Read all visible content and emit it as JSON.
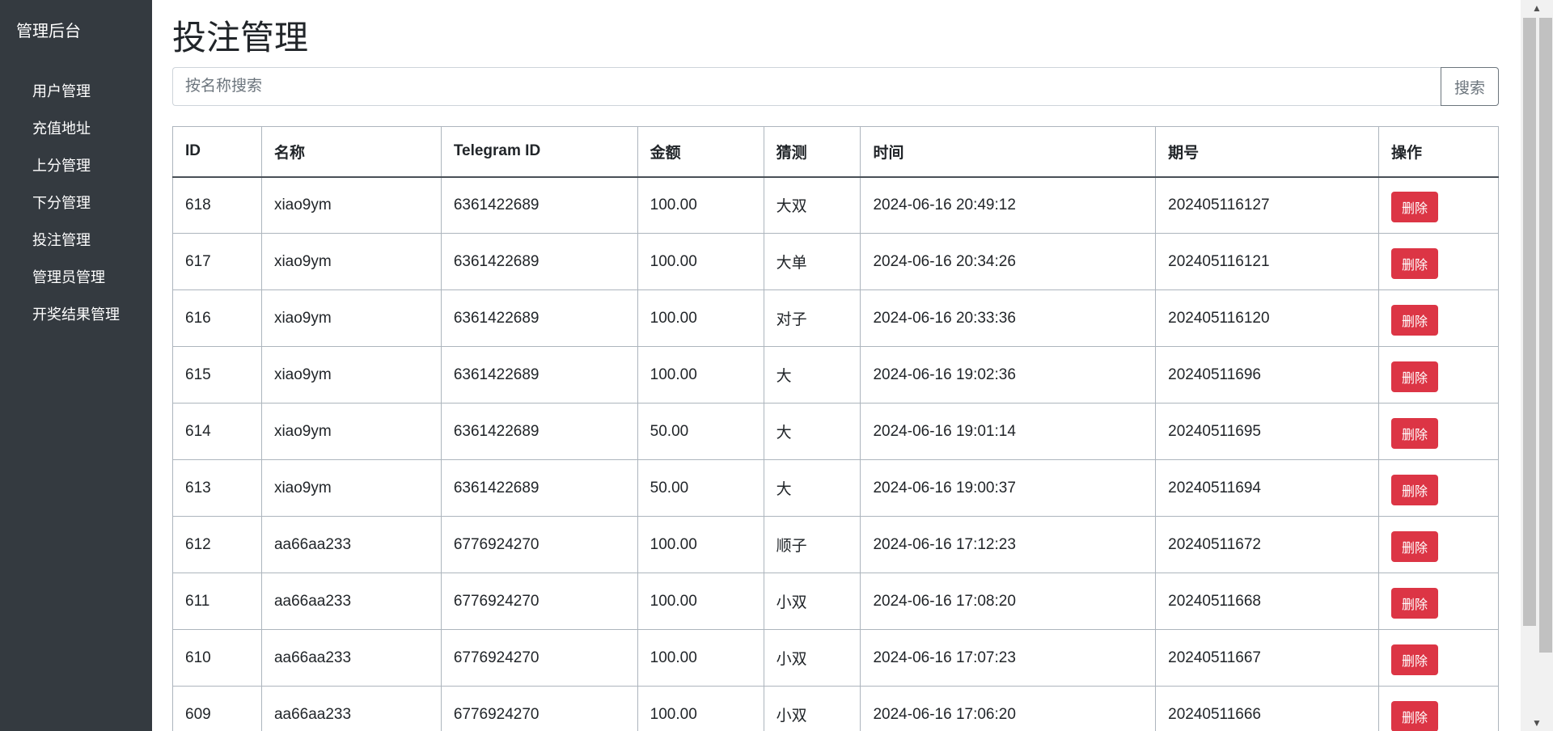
{
  "sidebar": {
    "brand": "管理后台",
    "items": [
      {
        "label": "用户管理"
      },
      {
        "label": "充值地址"
      },
      {
        "label": "上分管理"
      },
      {
        "label": "下分管理"
      },
      {
        "label": "投注管理"
      },
      {
        "label": "管理员管理"
      },
      {
        "label": "开奖结果管理"
      }
    ]
  },
  "main": {
    "title": "投注管理",
    "search": {
      "placeholder": "按名称搜索",
      "value": "",
      "button_label": "搜索"
    },
    "table": {
      "headers": [
        "ID",
        "名称",
        "Telegram ID",
        "金额",
        "猜测",
        "时间",
        "期号",
        "操作"
      ],
      "delete_label": "删除",
      "rows": [
        {
          "id": "618",
          "name": "xiao9ym",
          "tg": "6361422689",
          "amount": "100.00",
          "guess": "大双",
          "time": "2024-06-16 20:49:12",
          "issue": "202405116127"
        },
        {
          "id": "617",
          "name": "xiao9ym",
          "tg": "6361422689",
          "amount": "100.00",
          "guess": "大单",
          "time": "2024-06-16 20:34:26",
          "issue": "202405116121"
        },
        {
          "id": "616",
          "name": "xiao9ym",
          "tg": "6361422689",
          "amount": "100.00",
          "guess": "对子",
          "time": "2024-06-16 20:33:36",
          "issue": "202405116120"
        },
        {
          "id": "615",
          "name": "xiao9ym",
          "tg": "6361422689",
          "amount": "100.00",
          "guess": "大",
          "time": "2024-06-16 19:02:36",
          "issue": "20240511696"
        },
        {
          "id": "614",
          "name": "xiao9ym",
          "tg": "6361422689",
          "amount": "50.00",
          "guess": "大",
          "time": "2024-06-16 19:01:14",
          "issue": "20240511695"
        },
        {
          "id": "613",
          "name": "xiao9ym",
          "tg": "6361422689",
          "amount": "50.00",
          "guess": "大",
          "time": "2024-06-16 19:00:37",
          "issue": "20240511694"
        },
        {
          "id": "612",
          "name": "aa66aa233",
          "tg": "6776924270",
          "amount": "100.00",
          "guess": "顺子",
          "time": "2024-06-16 17:12:23",
          "issue": "20240511672"
        },
        {
          "id": "611",
          "name": "aa66aa233",
          "tg": "6776924270",
          "amount": "100.00",
          "guess": "小双",
          "time": "2024-06-16 17:08:20",
          "issue": "20240511668"
        },
        {
          "id": "610",
          "name": "aa66aa233",
          "tg": "6776924270",
          "amount": "100.00",
          "guess": "小双",
          "time": "2024-06-16 17:07:23",
          "issue": "20240511667"
        },
        {
          "id": "609",
          "name": "aa66aa233",
          "tg": "6776924270",
          "amount": "100.00",
          "guess": "小双",
          "time": "2024-06-16 17:06:20",
          "issue": "20240511666"
        }
      ]
    }
  },
  "colors": {
    "sidebar_bg": "#343a40",
    "danger": "#dc3545",
    "scrollbar_thumb": "#c1c1c1"
  },
  "icons": {
    "scroll_up": "scroll-up-arrow-icon",
    "scroll_down": "scroll-down-arrow-icon"
  }
}
